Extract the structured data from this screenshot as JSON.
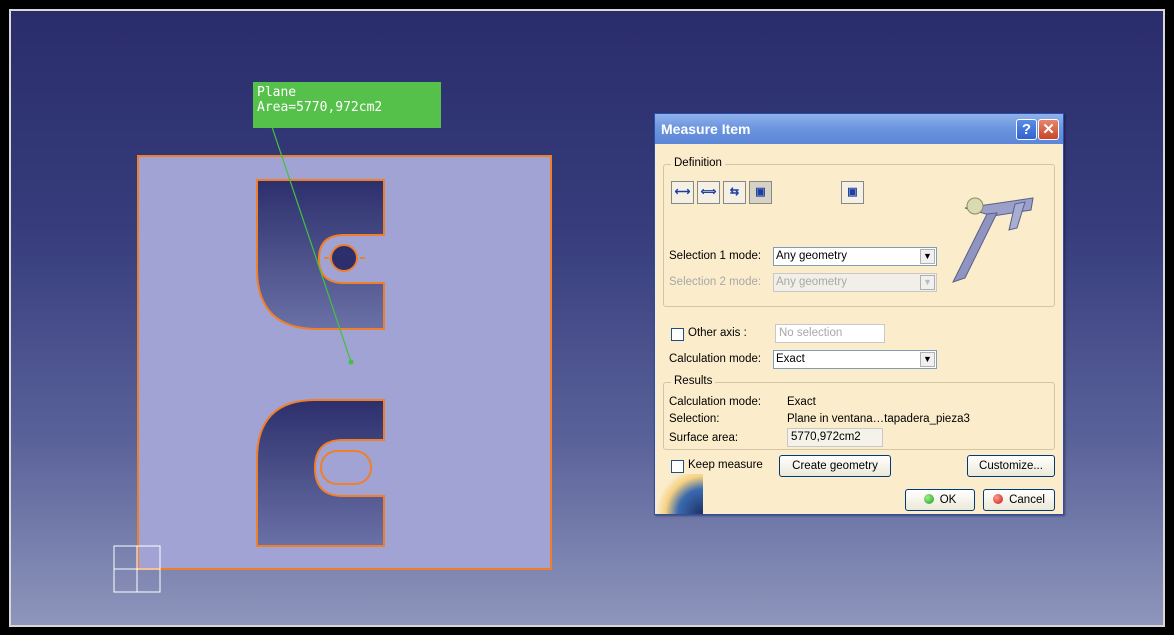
{
  "annotation": {
    "line1": "Plane",
    "line2": "Area=5770,972cm2"
  },
  "dialog": {
    "title": "Measure Item",
    "help_icon": "?",
    "close_icon": "✕",
    "definition": {
      "legend": "Definition",
      "tool_icons": [
        "measure-between-icon",
        "measure-between-chain-icon",
        "measure-between-fan-icon",
        "measure-item-icon",
        "measure-thickness-icon"
      ],
      "selection1_label": "Selection 1 mode:",
      "selection1_value": "Any geometry",
      "selection2_label": "Selection 2 mode:",
      "selection2_value": "Any geometry"
    },
    "other_axis": {
      "label": "Other axis :",
      "placeholder": "No selection",
      "checked": false
    },
    "calculation": {
      "label": "Calculation mode:",
      "value": "Exact"
    },
    "results": {
      "legend": "Results",
      "calc_mode_label": "Calculation mode:",
      "calc_mode_value": "Exact",
      "selection_label": "Selection:",
      "selection_value": "Plane in ventana…tapadera_pieza3",
      "surface_area_label": "Surface area:",
      "surface_area_value": "5770,972cm2"
    },
    "keep_measure": {
      "label": "Keep measure",
      "checked": false
    },
    "buttons": {
      "create_geometry": "Create geometry",
      "customize": "Customize...",
      "ok": "OK",
      "cancel": "Cancel"
    }
  },
  "colors": {
    "part_outline": "#f07f2a",
    "part_face": "#a0a3d4",
    "annotation_bg": "#55c04a",
    "titlebar": "#6d96e0"
  }
}
